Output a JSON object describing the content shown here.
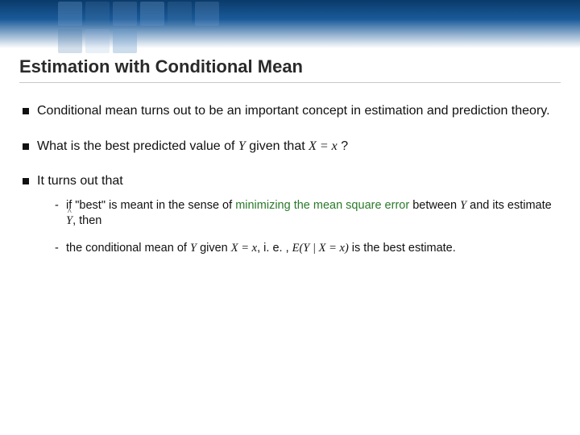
{
  "title": "Estimation with Conditional Mean",
  "bullets": {
    "b1": "Conditional mean turns out to be an important concept in estimation and prediction theory.",
    "b2_pre": "What is the best predicted value of ",
    "b2_Y": "Y",
    "b2_mid": " given that  ",
    "b2_eq": "X = x",
    "b2_post": " ?",
    "b3": "It turns out that"
  },
  "sub": {
    "s1_pre": "if \"best\" is meant in the sense of ",
    "s1_hl": "minimizing the mean square error",
    "s1_mid": " between ",
    "s1_Y": "Y",
    "s1_post1": " and its estimate  ",
    "s1_yhat": "Y",
    "s1_post2": ", then",
    "s2_pre": "the conditional mean of ",
    "s2_Y": "Y",
    "s2_given": " given ",
    "s2_eq": "X = x",
    "s2_ie": ", i. e. , ",
    "s2_formula": "E(Y | X = x)",
    "s2_post": " is the best estimate."
  }
}
